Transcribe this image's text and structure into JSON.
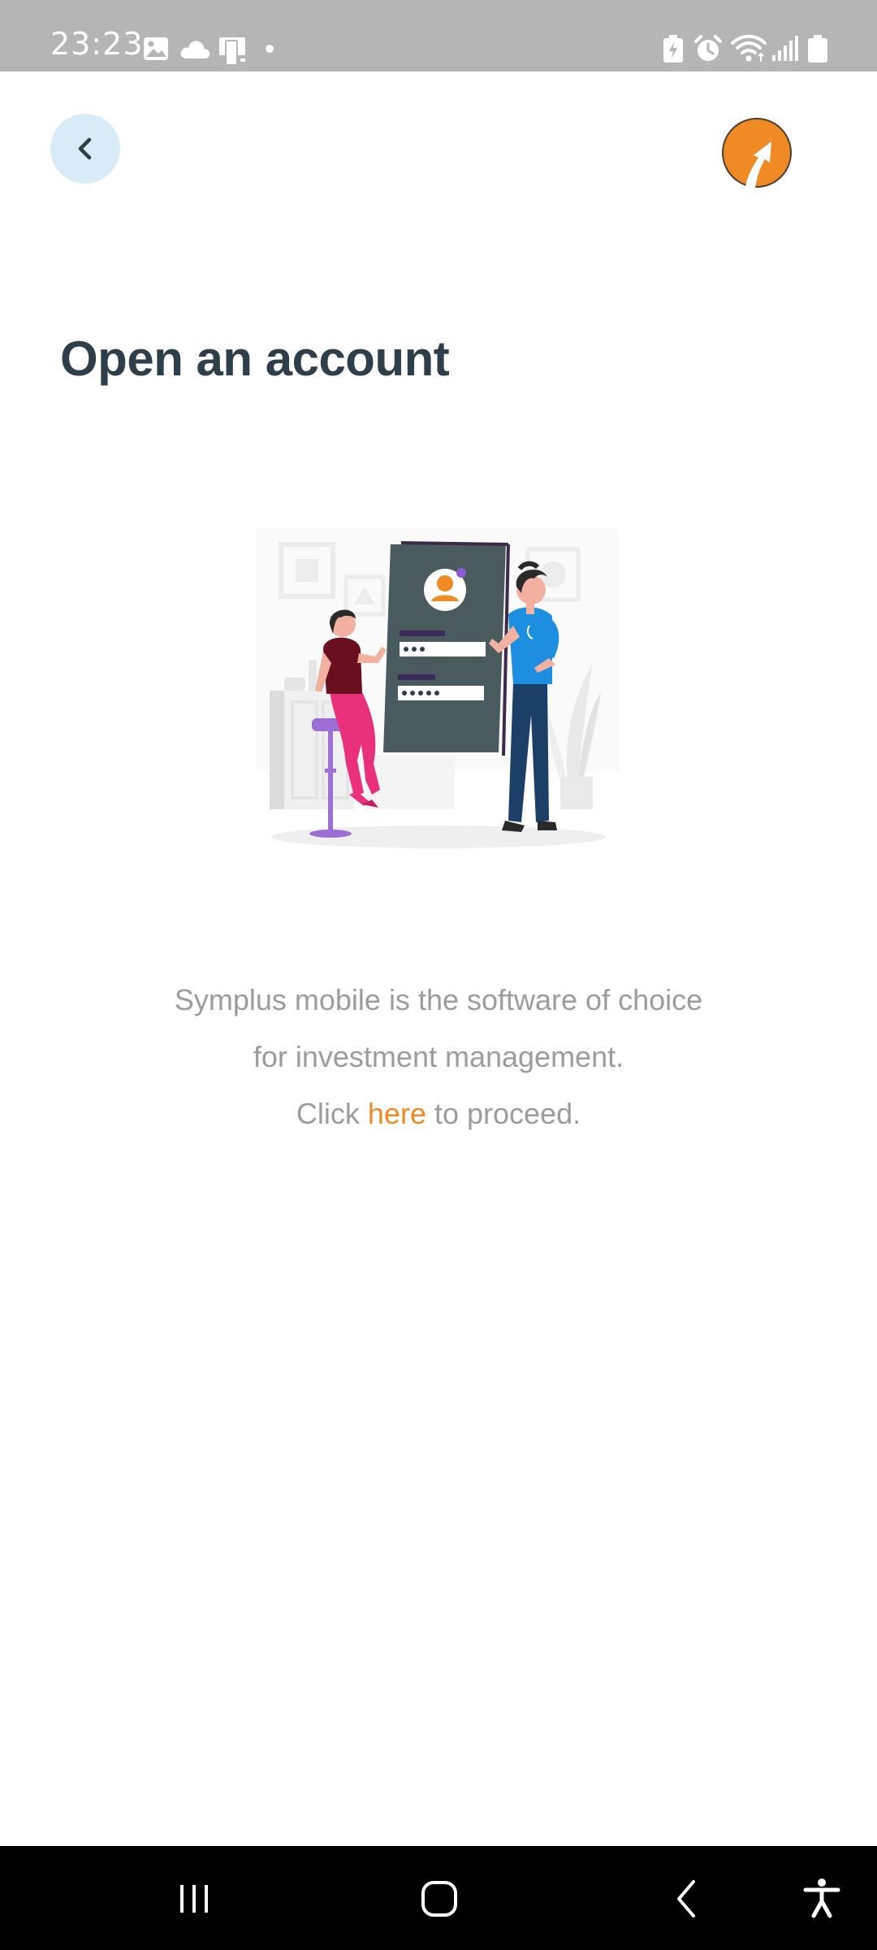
{
  "status_bar": {
    "time": "23:23",
    "left_icons": [
      "image-icon",
      "cloud-icon",
      "device-icon",
      "dot-icon"
    ],
    "right_icons": [
      "battery-saver-icon",
      "alarm-icon",
      "wifi-icon",
      "signal-icon",
      "battery-icon"
    ]
  },
  "header": {
    "back_icon": "chevron-left-icon",
    "logo_icon": "arrow-logo-icon"
  },
  "page": {
    "title": "Open an account",
    "illustration_icon": "account-signup-illustration"
  },
  "description": {
    "line1": "Symplus mobile is the software of choice",
    "line2": "for investment management.",
    "line3_prefix": "Click ",
    "line3_link": "here",
    "line3_suffix": " to proceed."
  },
  "nav_bar": {
    "icons": [
      "recent-apps-icon",
      "home-icon",
      "back-icon",
      "accessibility-icon"
    ]
  },
  "colors": {
    "accent": "#f08a24",
    "title": "#2f3f4a",
    "body_text": "#9c9c9c",
    "back_button_bg": "#d8ebf7",
    "status_bar": "#b5b5b5"
  }
}
